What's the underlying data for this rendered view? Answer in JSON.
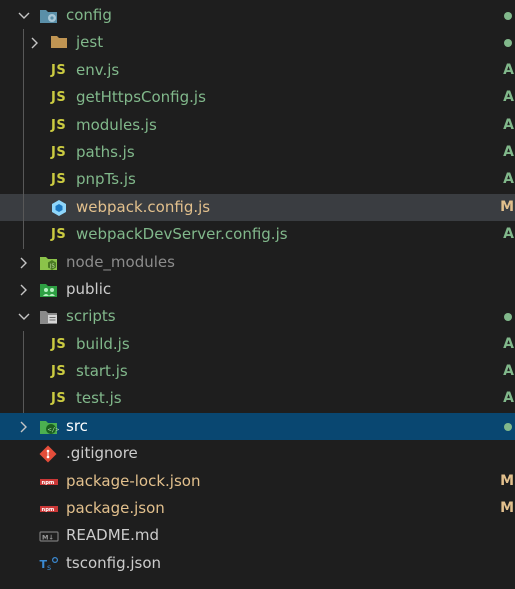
{
  "explorer": {
    "colors": {
      "added": "#81b88b",
      "modified": "#e2c08d",
      "default": "#cccccc",
      "ignored": "#8c8c8c",
      "selection": "#094771",
      "hover": "#3a3d41",
      "js_icon": "#cbcb41"
    },
    "items": [
      {
        "label": "config",
        "type": "folder",
        "expanded": true,
        "icon": "config-folder-icon",
        "status_dot": true
      },
      {
        "label": "jest",
        "type": "folder",
        "expanded": false,
        "icon": "folder-icon",
        "status_dot": true
      },
      {
        "label": "env.js",
        "type": "file",
        "icon_text": "JS",
        "status": "A"
      },
      {
        "label": "getHttpsConfig.js",
        "type": "file",
        "icon_text": "JS",
        "status": "A"
      },
      {
        "label": "modules.js",
        "type": "file",
        "icon_text": "JS",
        "status": "A"
      },
      {
        "label": "paths.js",
        "type": "file",
        "icon_text": "JS",
        "status": "A"
      },
      {
        "label": "pnpTs.js",
        "type": "file",
        "icon_text": "JS",
        "status": "A"
      },
      {
        "label": "webpack.config.js",
        "type": "file",
        "icon": "webpack-icon",
        "status": "M"
      },
      {
        "label": "webpackDevServer.config.js",
        "type": "file",
        "icon_text": "JS",
        "status": "A"
      },
      {
        "label": "node_modules",
        "type": "folder",
        "expanded": false,
        "icon": "node-modules-folder-icon"
      },
      {
        "label": "public",
        "type": "folder",
        "expanded": false,
        "icon": "public-folder-icon"
      },
      {
        "label": "scripts",
        "type": "folder",
        "expanded": true,
        "icon": "scripts-folder-icon",
        "status_dot": true
      },
      {
        "label": "build.js",
        "type": "file",
        "icon_text": "JS",
        "status": "A"
      },
      {
        "label": "start.js",
        "type": "file",
        "icon_text": "JS",
        "status": "A"
      },
      {
        "label": "test.js",
        "type": "file",
        "icon_text": "JS",
        "status": "A"
      },
      {
        "label": "src",
        "type": "folder",
        "expanded": false,
        "icon": "src-folder-icon",
        "status_dot": true
      },
      {
        "label": ".gitignore",
        "type": "file",
        "icon": "git-icon"
      },
      {
        "label": "package-lock.json",
        "type": "file",
        "icon": "npm-icon",
        "status": "M"
      },
      {
        "label": "package.json",
        "type": "file",
        "icon": "npm-icon",
        "status": "M"
      },
      {
        "label": "README.md",
        "type": "file",
        "icon": "markdown-icon"
      },
      {
        "label": "tsconfig.json",
        "type": "file",
        "icon": "typescript-config-icon"
      }
    ]
  }
}
